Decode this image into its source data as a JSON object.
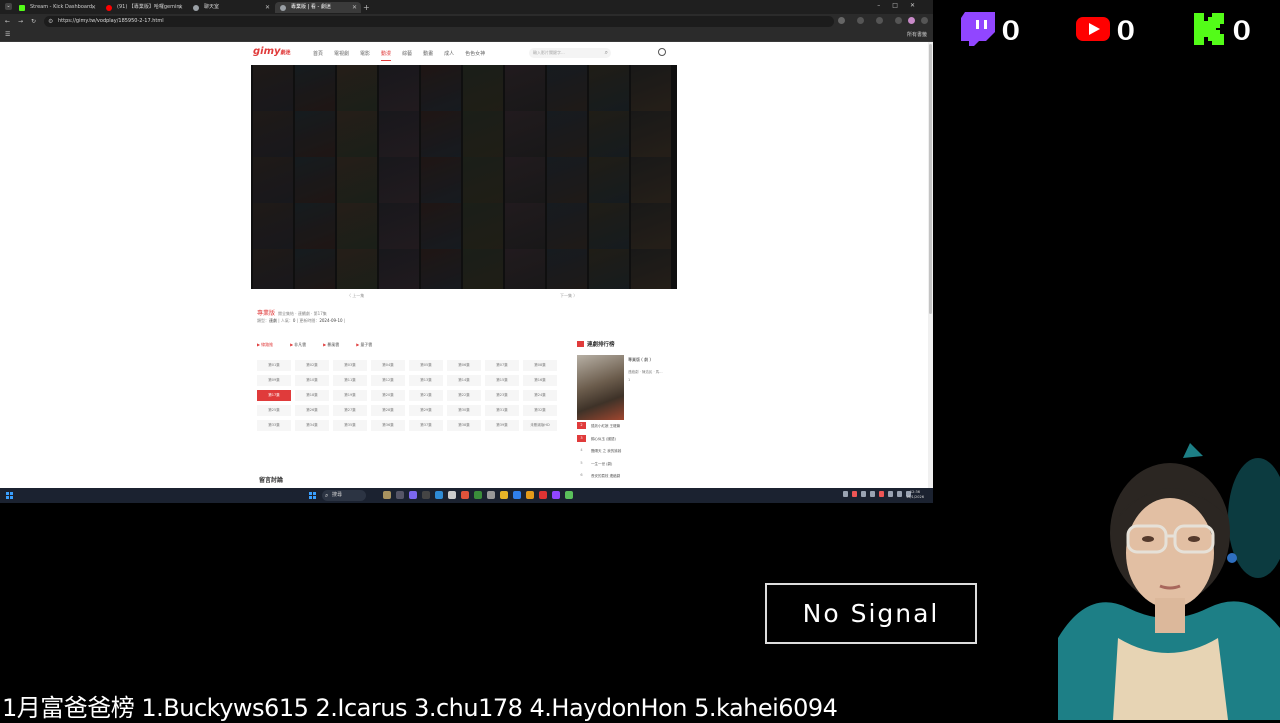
{
  "browser": {
    "tabs": [
      {
        "title": "Stream - Kick Dashboard",
        "icon_color": "#53fc18",
        "active": false
      },
      {
        "title": "(91) 【專業版】哈囉gemini",
        "icon_color": "#ff0000",
        "active": false
      },
      {
        "title": "聊天室",
        "icon_color": "#9aa0a6",
        "active": false
      },
      {
        "title": "專業版 | 看 - 劇迷",
        "icon_color": "#9aa0a6",
        "active": true
      }
    ],
    "new_tab": "+",
    "url": "https://gimy.tw/vodplay/185950-2-17.html",
    "all_bookmarks": "所有書籤"
  },
  "site": {
    "logo": "gimy",
    "logo_sub": "劇迷",
    "nav": [
      "首頁",
      "電視劇",
      "電影",
      "動漫",
      "綜藝",
      "動畫",
      "成人",
      "色色女神"
    ],
    "nav_active_index": 3,
    "search_placeholder": "輸入影片關鍵字..."
  },
  "player": {
    "prev": "〈 上一集",
    "next": "下一集 〉"
  },
  "video": {
    "title": "專業版",
    "subtitle": "閱全集結 · 連續劇 · 第17集",
    "meta_type_label": "類型：",
    "meta_type": "連劇",
    "meta_views_label": "人氣：",
    "meta_views": "0",
    "meta_update_label": "更新時間：",
    "meta_update": "2024-09-10"
  },
  "sources": [
    "線路推",
    "非凡雲",
    "暴風雲",
    "量子雲"
  ],
  "sources_active_index": 0,
  "episodes": [
    "第01集",
    "第02集",
    "第03集",
    "第04集",
    "第05集",
    "第06集",
    "第07集",
    "第08集",
    "第09集",
    "第10集",
    "第11集",
    "第12集",
    "第13集",
    "第14集",
    "第15集",
    "第16集",
    "第17集",
    "第18集",
    "第19集",
    "第20集",
    "第21集",
    "第22集",
    "第23集",
    "第24集",
    "第25集",
    "第26集",
    "第27集",
    "第28集",
    "第29集",
    "第30集",
    "第31集",
    "第32集",
    "第33集",
    "第34集",
    "第35集",
    "第36集",
    "第37集",
    "第38集",
    "第39集",
    "未刪減版HD"
  ],
  "episode_active_index": 16,
  "ranking": {
    "title": "連劇排行榜",
    "top_title": "專業版 ( 劇 )",
    "top_sub": "連續劇 · 陳浩民 · 馬…",
    "top_num": "1",
    "items": [
      {
        "n": "2",
        "title": "狐妖小紅娘 王權篇"
      },
      {
        "n": "3",
        "title": "錦心似玉 (國語)"
      },
      {
        "n": "4",
        "title": "艷陽天 之 我的姊姊"
      },
      {
        "n": "5",
        "title": "一生一世 (劇)"
      },
      {
        "n": "6",
        "title": "長安的荔枝 連續劇"
      }
    ]
  },
  "comments_title": "留言討論",
  "taskbar": {
    "search": "搜尋",
    "time": "12:36",
    "date": "16/1/2026"
  },
  "overlay": {
    "twitch_count": "0",
    "youtube_count": "0",
    "kick_count": "0",
    "twitch_color": "#9146ff",
    "youtube_color": "#ff0000",
    "kick_color": "#53fc18",
    "no_signal": "No Signal",
    "ticker": "1月富爸爸榜 1.Buckyws615 2.Icarus 3.chu178 4.HaydonHon 5.kahei6094"
  }
}
